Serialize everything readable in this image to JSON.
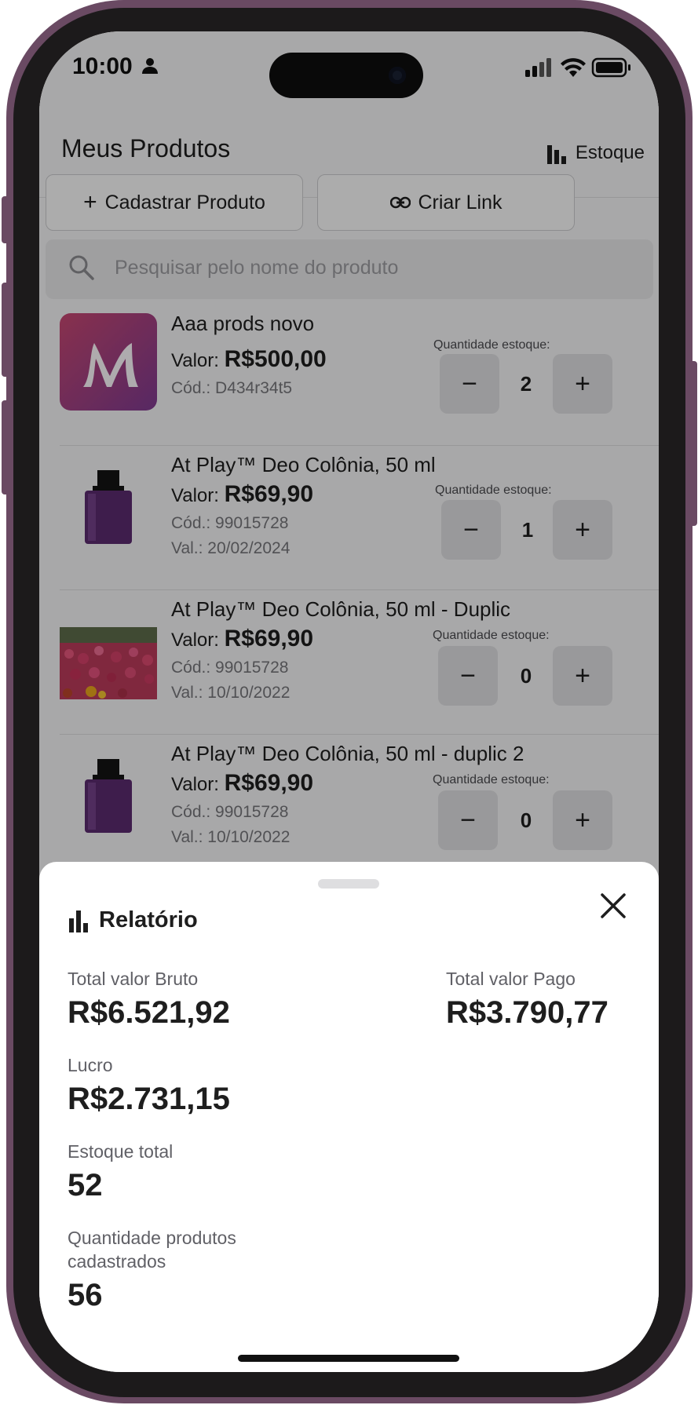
{
  "status_bar": {
    "time": "10:00"
  },
  "header": {
    "title": "Meus Produtos",
    "stock_label": "Estoque"
  },
  "actions": {
    "add_product": "Cadastrar Produto",
    "create_link": "Criar Link"
  },
  "search": {
    "placeholder": "Pesquisar pelo nome do produto"
  },
  "products": [
    {
      "name": "Aaa prods novo",
      "price_prefix": "Valor:",
      "price": "R$500,00",
      "code": "Cód.: D434r34t5",
      "validity": "",
      "qty_label": "Quantidade estoque:",
      "qty": "2",
      "thumb": "logo-m"
    },
    {
      "name": "At Play™ Deo Colônia, 50 ml",
      "price_prefix": "Valor:",
      "price": "R$69,90",
      "code": "Cód.: 99015728",
      "validity": "Val.: 20/02/2024",
      "qty_label": "Quantidade estoque:",
      "qty": "1",
      "thumb": "perfume"
    },
    {
      "name": "At Play™ Deo Colônia, 50 ml - Duplic",
      "price_prefix": "Valor:",
      "price": "R$69,90",
      "code": "Cód.: 99015728",
      "validity": "Val.: 10/10/2022",
      "qty_label": "Quantidade estoque:",
      "qty": "0",
      "thumb": "flowers"
    },
    {
      "name": "At Play™ Deo Colônia, 50 ml - duplic 2",
      "price_prefix": "Valor:",
      "price": "R$69,90",
      "code": "Cód.: 99015728",
      "validity": "Val.: 10/10/2022",
      "qty_label": "Quantidade estoque:",
      "qty": "0",
      "thumb": "perfume"
    }
  ],
  "report": {
    "title": "Relatório",
    "gross_label": "Total valor Bruto",
    "gross_value": "R$6.521,92",
    "paid_label": "Total valor Pago",
    "paid_value": "R$3.790,77",
    "profit_label": "Lucro",
    "profit_value": "R$2.731,15",
    "stock_label": "Estoque total",
    "stock_value": "52",
    "products_label_line1": "Quantidade produtos",
    "products_label_line2": "cadastrados",
    "products_value": "56"
  },
  "colors": {
    "frame": "#6a4a63",
    "logo_gradient_start": "#c4466f",
    "logo_gradient_end": "#7d3a8f",
    "perfume": "#5a2a6e"
  }
}
